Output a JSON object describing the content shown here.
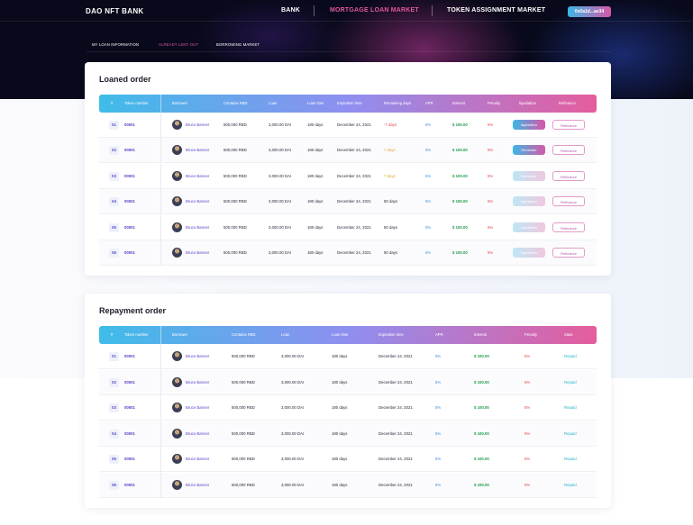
{
  "header": {
    "brand": "DAO NFT BANK",
    "nav": [
      {
        "label": "BANK",
        "active": false
      },
      {
        "label": "MORTGAGE LOAN MARKET",
        "active": true
      },
      {
        "label": "TOKEN ASSIGNMENT MARKET",
        "active": false
      }
    ],
    "wallet": "0x0a1d...ae34"
  },
  "subtabs": [
    {
      "label": "MY LOAN INFORMATION",
      "active": false
    },
    {
      "label": "ALREADY LENT OUT",
      "active": true
    },
    {
      "label": "BORROWING MARKET",
      "active": false
    }
  ],
  "loaned": {
    "title": "Loaned order",
    "columns": [
      "#",
      "Token number",
      "Borrower",
      "Contains RBD",
      "Loan",
      "Loan time",
      "Expiration time",
      "Remaining days",
      "APR",
      "Interest",
      "Penalty",
      "liquidation",
      "Refinance"
    ],
    "rows": [
      {
        "idx": "01",
        "token": "00001",
        "borrower": "Bruce Banner",
        "rbd": "500,000 RBD",
        "loan": "3,000.00 DAI",
        "loan_time": "180 days",
        "expiration": "December 24, 2021",
        "remaining": "-7 days",
        "remaining_tone": "neg",
        "apr": "6%",
        "interest": "$ 100.00",
        "penalty": "5%",
        "liq": "liquidation",
        "liq_style": "solid",
        "refinance": "Refinance"
      },
      {
        "idx": "02",
        "token": "00001",
        "borrower": "Bruce Banner",
        "rbd": "500,000 RBD",
        "loan": "3,000.00 DAI",
        "loan_time": "180 days",
        "expiration": "December 24, 2021",
        "remaining": "7 days",
        "remaining_tone": "warn",
        "apr": "5%",
        "interest": "$ 100.00",
        "penalty": "5%",
        "liq": "Reminder",
        "liq_style": "solid",
        "refinance": "Refinance"
      },
      {
        "idx": "03",
        "token": "00001",
        "borrower": "Bruce Banner",
        "rbd": "500,000 RBD",
        "loan": "3,000.00 DAI",
        "loan_time": "180 days",
        "expiration": "December 24, 2021",
        "remaining": "7 days",
        "remaining_tone": "warn",
        "apr": "5%",
        "interest": "$ 100.00",
        "penalty": "5%",
        "liq": "Reminder",
        "liq_style": "faded",
        "refinance": "Refinance"
      },
      {
        "idx": "04",
        "token": "00001",
        "borrower": "Bruce Banner",
        "rbd": "500,000 RBD",
        "loan": "3,000.00 DAI",
        "loan_time": "180 days",
        "expiration": "December 24, 2021",
        "remaining": "50 days",
        "remaining_tone": "normal",
        "apr": "5%",
        "interest": "$ 100.00",
        "penalty": "5%",
        "liq": "liquidation",
        "liq_style": "faded",
        "refinance": "Refinance"
      },
      {
        "idx": "05",
        "token": "00001",
        "borrower": "Bruce Banner",
        "rbd": "500,000 RBD",
        "loan": "3,000.00 DAI",
        "loan_time": "180 days",
        "expiration": "December 24, 2021",
        "remaining": "50 days",
        "remaining_tone": "normal",
        "apr": "5%",
        "interest": "$ 100.00",
        "penalty": "6%",
        "liq": "liquidation",
        "liq_style": "faded",
        "refinance": "Refinance"
      },
      {
        "idx": "06",
        "token": "00001",
        "borrower": "Bruce Banner",
        "rbd": "500,000 RBD",
        "loan": "3,000.00 DAI",
        "loan_time": "180 days",
        "expiration": "December 24, 2021",
        "remaining": "50 days",
        "remaining_tone": "normal",
        "apr": "5%",
        "interest": "$ 100.00",
        "penalty": "5%",
        "liq": "liquidation",
        "liq_style": "faded",
        "refinance": "Refinance"
      }
    ]
  },
  "repayment": {
    "title": "Repayment order",
    "columns": [
      "#",
      "Token number",
      "Borrower",
      "Contains RBD",
      "Loan",
      "Loan time",
      "Expiration time",
      "APR",
      "Interest",
      "Penalty",
      "State"
    ],
    "rows": [
      {
        "idx": "01",
        "token": "00001",
        "borrower": "Bruce Banner",
        "rbd": "500,000 RBD",
        "loan": "3,000.00 DAI",
        "loan_time": "180 days",
        "expiration": "December 24, 2021",
        "apr": "6%",
        "interest": "$ 100.00",
        "penalty": "5%",
        "state": "Repaid"
      },
      {
        "idx": "02",
        "token": "00001",
        "borrower": "Bruce Banner",
        "rbd": "500,000 RBD",
        "loan": "3,000.00 DAI",
        "loan_time": "180 days",
        "expiration": "December 24, 2021",
        "apr": "5%",
        "interest": "$ 100.00",
        "penalty": "5%",
        "state": "Repaid"
      },
      {
        "idx": "03",
        "token": "00001",
        "borrower": "Bruce Banner",
        "rbd": "500,000 RBD",
        "loan": "3,000.00 DAI",
        "loan_time": "180 days",
        "expiration": "December 24, 2021",
        "apr": "5%",
        "interest": "$ 100.00",
        "penalty": "5%",
        "state": "Repaid"
      },
      {
        "idx": "04",
        "token": "00001",
        "borrower": "Bruce Banner",
        "rbd": "500,000 RBD",
        "loan": "3,000.00 DAI",
        "loan_time": "180 days",
        "expiration": "December 24, 2021",
        "apr": "5%",
        "interest": "$ 100.00",
        "penalty": "5%",
        "state": "Repaid"
      },
      {
        "idx": "05",
        "token": "00001",
        "borrower": "Bruce Banner",
        "rbd": "500,000 RBD",
        "loan": "3,000.00 DAI",
        "loan_time": "180 days",
        "expiration": "December 24, 2021",
        "apr": "5%",
        "interest": "$ 100.00",
        "penalty": "5%",
        "state": "Repaid"
      },
      {
        "idx": "06",
        "token": "00001",
        "borrower": "Bruce Banner",
        "rbd": "500,000 RBD",
        "loan": "3,000.00 DAI",
        "loan_time": "180 days",
        "expiration": "December 24, 2021",
        "apr": "5%",
        "interest": "$ 100.00",
        "penalty": "5%",
        "state": "Repaid"
      }
    ]
  },
  "colors": {
    "accent_pink": "#e0579f",
    "accent_blue": "#3bb7e6",
    "purple": "#5b3dc9"
  }
}
